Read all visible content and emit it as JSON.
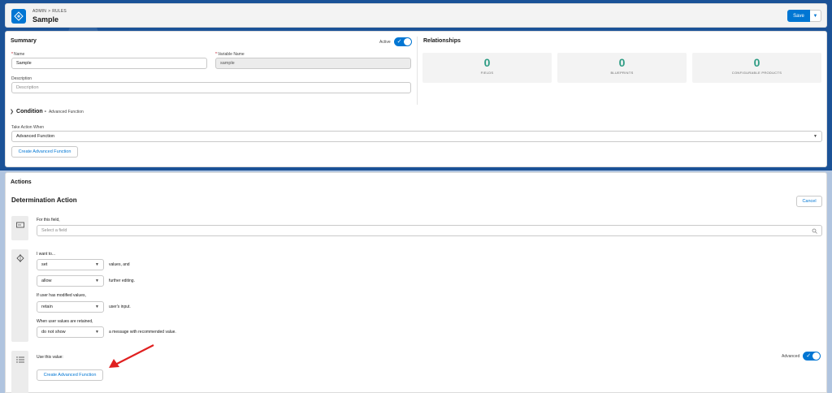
{
  "header": {
    "breadcrumb": [
      "ADMIN",
      "RULES"
    ],
    "breadcrumb_sep": ">",
    "title": "Sample",
    "save_label": "Save",
    "save_menu_icon": "chevron-down-icon",
    "app_icon": "rules-icon"
  },
  "summary": {
    "title": "Summary",
    "active_label": "Active",
    "active": true,
    "name_label": "Name",
    "name_value": "Sample",
    "variable_label": "Variable Name",
    "variable_value": "sample",
    "description_label": "Description",
    "description_placeholder": "Description",
    "condition_title": "Condition -",
    "condition_sub": "Advanced Function",
    "take_action_label": "Take Action When",
    "take_action_value": "Advanced Function",
    "create_function_label": "Create Advanced Function"
  },
  "relationships": {
    "title": "Relationships",
    "stats": [
      {
        "value": "0",
        "label": "FIELDS"
      },
      {
        "value": "0",
        "label": "BLUEPRINTS"
      },
      {
        "value": "0",
        "label": "CONFIGURABLE PRODUCTS"
      }
    ]
  },
  "actions": {
    "title": "Actions",
    "determination_title": "Determination Action",
    "cancel_label": "Cancel",
    "for_field_label": "For this field,",
    "select_field_placeholder": "Select a field",
    "want_to_label": "I want to...",
    "set_value": "set",
    "values_and": "values, and",
    "allow_value": "allow",
    "further_editing": "further editing.",
    "modified_label": "If user has modified values,",
    "retain_value": "retain",
    "users_input": "user's input.",
    "retained_label": "When user values are retained,",
    "do_not_show_value": "do not show",
    "message_text": "a message with recommended value.",
    "use_value_label": "Use this value:",
    "advanced_label": "Advanced",
    "advanced": true,
    "create_function_label": "Create Advanced Function"
  },
  "colors": {
    "brand": "#0176d3",
    "stat": "#2e9c84",
    "arrow": "#e02020",
    "band": "#1b5297"
  }
}
